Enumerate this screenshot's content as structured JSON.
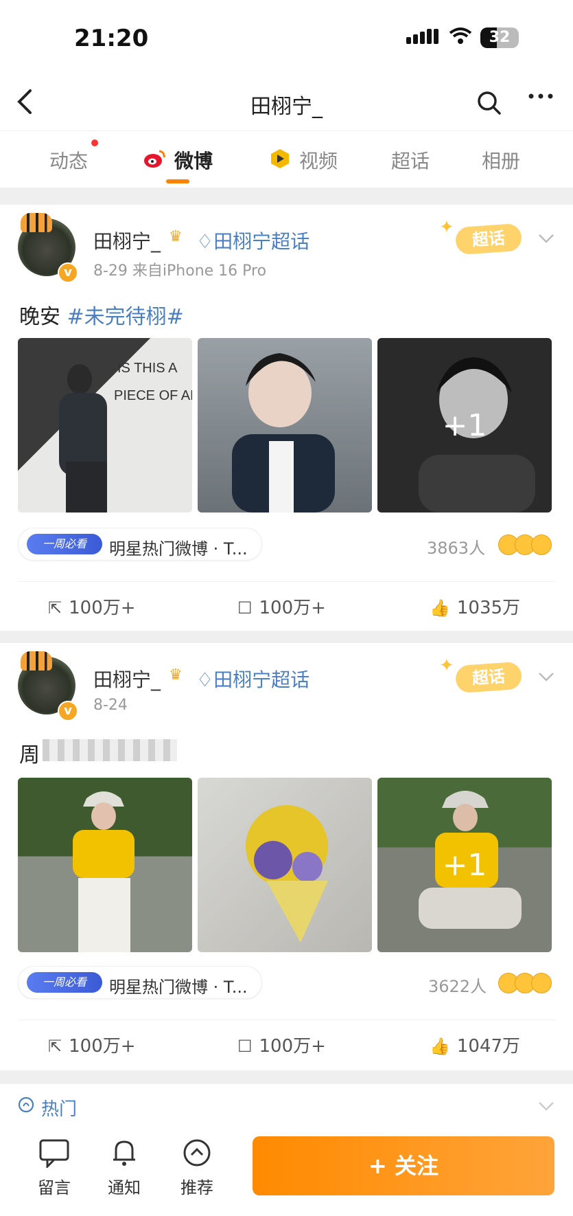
{
  "status": {
    "time": "21:20",
    "battery": "32"
  },
  "header": {
    "title": "田栩宁_",
    "back_icon": "chevron-left-icon",
    "search_icon": "search-icon",
    "more_icon": "more-icon"
  },
  "tabs": [
    {
      "label": "动态",
      "has_dot": true
    },
    {
      "label": "微博",
      "active": true
    },
    {
      "label": "视频"
    },
    {
      "label": "超话"
    },
    {
      "label": "相册"
    }
  ],
  "posts": [
    {
      "user": "田栩宁_",
      "topic": "♢田栩宁超话",
      "time_source": "8-29  来自iPhone 16 Pro",
      "badge": "超话",
      "text": "晚安 ",
      "hashtag": "#未完待栩#",
      "image_more": "+1",
      "pill_tag": "一周必看",
      "pill_text": "明星热门微博 · T...",
      "reactions_count": "3863人",
      "repost": "100万+",
      "comment": "100万+",
      "like": "1035万"
    },
    {
      "user": "田栩宁_",
      "topic": "♢田栩宁超话",
      "time_source": "8-24",
      "badge": "超话",
      "text": "周",
      "hashtag": "",
      "image_more": "+1",
      "pill_tag": "一周必看",
      "pill_text": "明星热门微博 · T...",
      "reactions_count": "3622人",
      "repost": "100万+",
      "comment": "100万+",
      "like": "1047万"
    }
  ],
  "hot": {
    "label": "热门"
  },
  "bottom": {
    "items": [
      {
        "label": "留言",
        "icon": "message-icon"
      },
      {
        "label": "通知",
        "icon": "bell-icon"
      },
      {
        "label": "推荐",
        "icon": "recommend-icon"
      }
    ],
    "follow": "+ 关注"
  },
  "colors": {
    "accent": "#ff8200",
    "link": "#4a7fc1",
    "follow_button": "#ff8a00"
  }
}
